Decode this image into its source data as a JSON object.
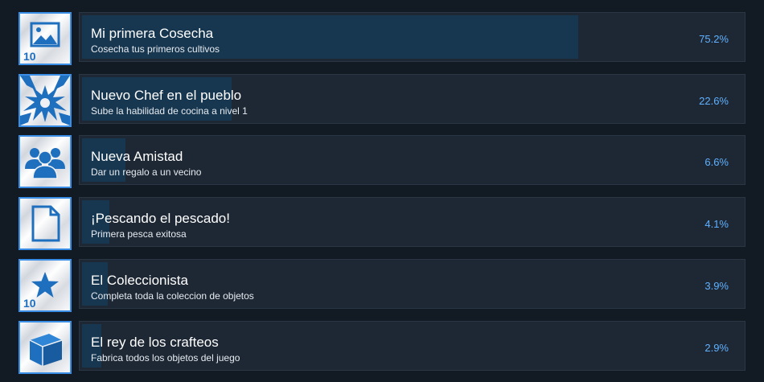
{
  "achievements": [
    {
      "title": "Mi primera Cosecha",
      "description": "Cosecha tus primeros cultivos",
      "percent_label": "75.2%",
      "percent": 75.2,
      "icon": "image-icon",
      "badge": "10"
    },
    {
      "title": "Nuevo Chef en el pueblo",
      "description": "Sube la habilidad de cocina a nivel 1",
      "percent_label": "22.6%",
      "percent": 22.6,
      "icon": "burst-icon",
      "badge": ""
    },
    {
      "title": "Nueva Amistad",
      "description": "Dar un regalo a un vecino",
      "percent_label": "6.6%",
      "percent": 6.6,
      "icon": "people-icon",
      "badge": ""
    },
    {
      "title": "¡Pescando el pescado!",
      "description": "Primera pesca exitosa",
      "percent_label": "4.1%",
      "percent": 4.1,
      "icon": "document-icon",
      "badge": ""
    },
    {
      "title": "El Coleccionista",
      "description": "Completa toda la coleccion de objetos",
      "percent_label": "3.9%",
      "percent": 3.9,
      "icon": "star-icon",
      "badge": "10"
    },
    {
      "title": "El rey de los crafteos",
      "description": "Fabrica todos los objetos del juego",
      "percent_label": "2.9%",
      "percent": 2.9,
      "icon": "box-icon",
      "badge": ""
    }
  ],
  "colors": {
    "accent": "#3a8ee6",
    "percent_text": "#5fb1ff",
    "row_bg": "#1e2835",
    "fill": "#17364f",
    "page_bg": "#121a24"
  }
}
